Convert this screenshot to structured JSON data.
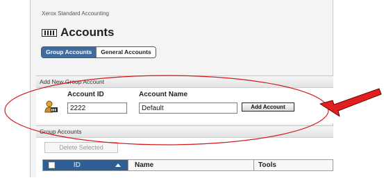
{
  "app": {
    "breadcrumb": "Xerox Standard Accounting",
    "title": "Accounts"
  },
  "tabs": [
    {
      "label": "Group Accounts",
      "active": true
    },
    {
      "label": "General Accounts",
      "active": false
    }
  ],
  "add_group": {
    "header": "Add New Group Account",
    "account_id_label": "Account ID",
    "account_id_value": "2222",
    "account_name_label": "Account Name",
    "account_name_value": "Default",
    "add_button": "Add Account"
  },
  "group_accounts": {
    "header": "Group Accounts",
    "delete_button": "Delete Selected",
    "columns": [
      "ID",
      "Name",
      "Tools"
    ],
    "sort": {
      "column": "ID",
      "direction": "ascending"
    }
  },
  "annotations": {
    "ellipse_color": "#d21a1a",
    "arrow_color": "#e02020"
  },
  "colors": {
    "active_tab": "#3f6b9f",
    "sorted_column_header": "#2f5e94"
  },
  "icons": [
    "account-list-icon",
    "user-account-icon",
    "sort-ascending-icon"
  ]
}
